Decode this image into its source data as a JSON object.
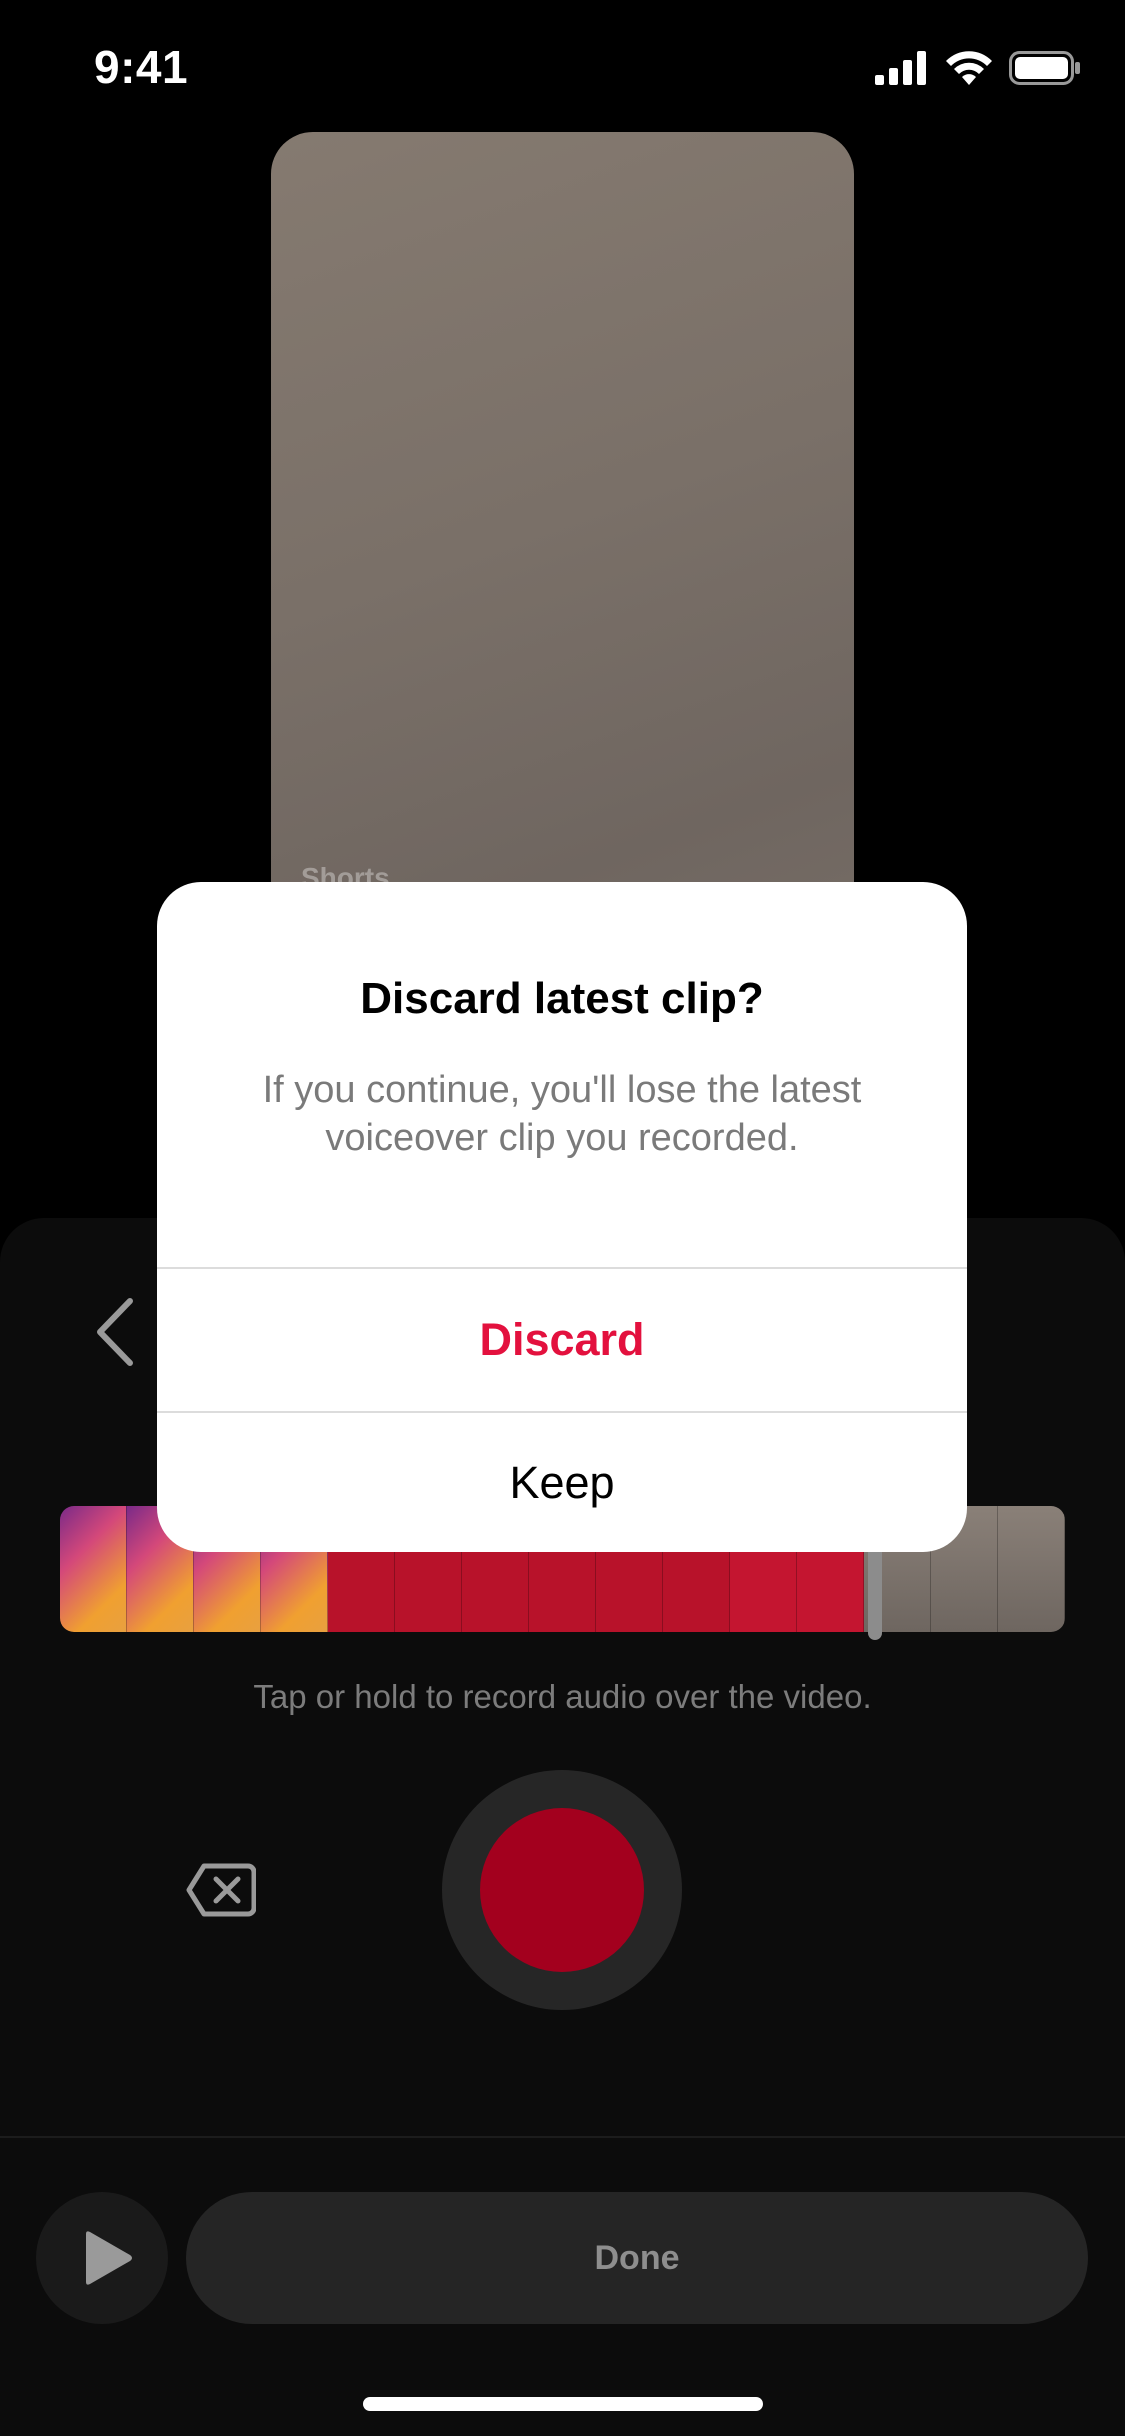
{
  "status_bar": {
    "time": "9:41",
    "icons": [
      "signal-icon",
      "wifi-icon",
      "battery-icon"
    ]
  },
  "video": {
    "watermark": "Shorts"
  },
  "editor": {
    "back_icon": "chevron-left-icon",
    "record_hint": "Tap or hold to record audio over the video.",
    "delete_icon": "delete-clip-icon",
    "record_color": "#a3001e",
    "play_icon": "play-icon",
    "done_label": "Done"
  },
  "alert": {
    "title": "Discard latest clip?",
    "message": "If you continue, you'll lose the latest voiceover clip you recorded.",
    "discard_label": "Discard",
    "keep_label": "Keep",
    "discard_color": "#e3113e"
  }
}
